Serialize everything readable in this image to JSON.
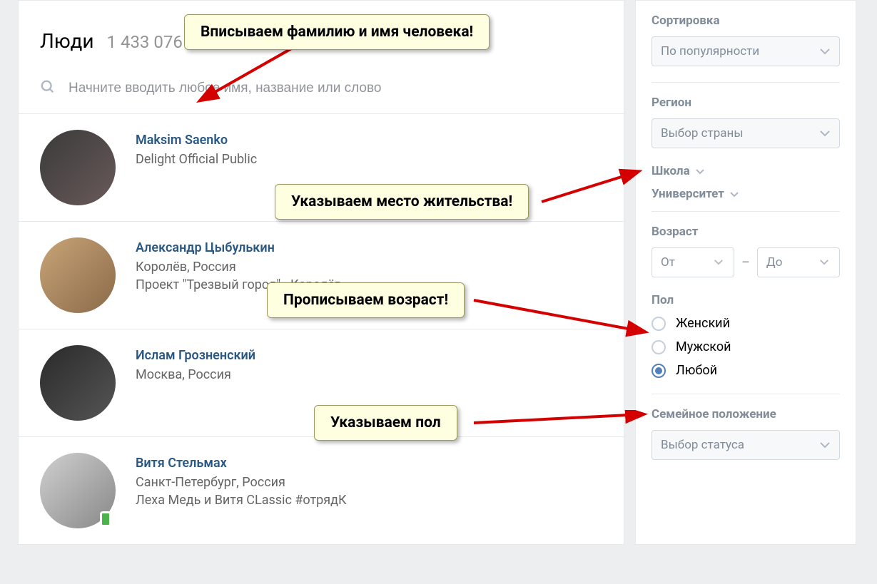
{
  "header": {
    "title": "Люди",
    "count": "1 433 076"
  },
  "search": {
    "placeholder": "Начните вводить любое имя, название или слово"
  },
  "people": [
    {
      "name": "Maksim Saenko",
      "line1": "Delight Official Public",
      "line2": "",
      "online": false
    },
    {
      "name": "Александр Цыбулькин",
      "line1": "Королёв, Россия",
      "line2": "Проект \"Трезвый город\" - Королёв",
      "online": false
    },
    {
      "name": "Ислам Грозненский",
      "line1": "Москва, Россия",
      "line2": "",
      "online": false
    },
    {
      "name": "Витя Стельмах",
      "line1": "Санкт-Петербург, Россия",
      "line2": "Леха Медь и Витя CLassic #отрядК",
      "online": true
    }
  ],
  "sidebar": {
    "sort_label": "Сортировка",
    "sort_value": "По популярности",
    "region_label": "Регион",
    "region_value": "Выбор страны",
    "school_label": "Школа",
    "university_label": "Университет",
    "age_label": "Возраст",
    "age_from": "От",
    "age_to": "До",
    "gender_label": "Пол",
    "gender_options": {
      "female": "Женский",
      "male": "Мужской",
      "any": "Любой"
    },
    "family_label": "Семейное положение",
    "family_value": "Выбор статуса"
  },
  "callouts": {
    "c1": "Вписываем фамилию и имя человека!",
    "c2": "Указываем место жительства!",
    "c3": "Прописываем возраст!",
    "c4": "Указываем пол"
  }
}
